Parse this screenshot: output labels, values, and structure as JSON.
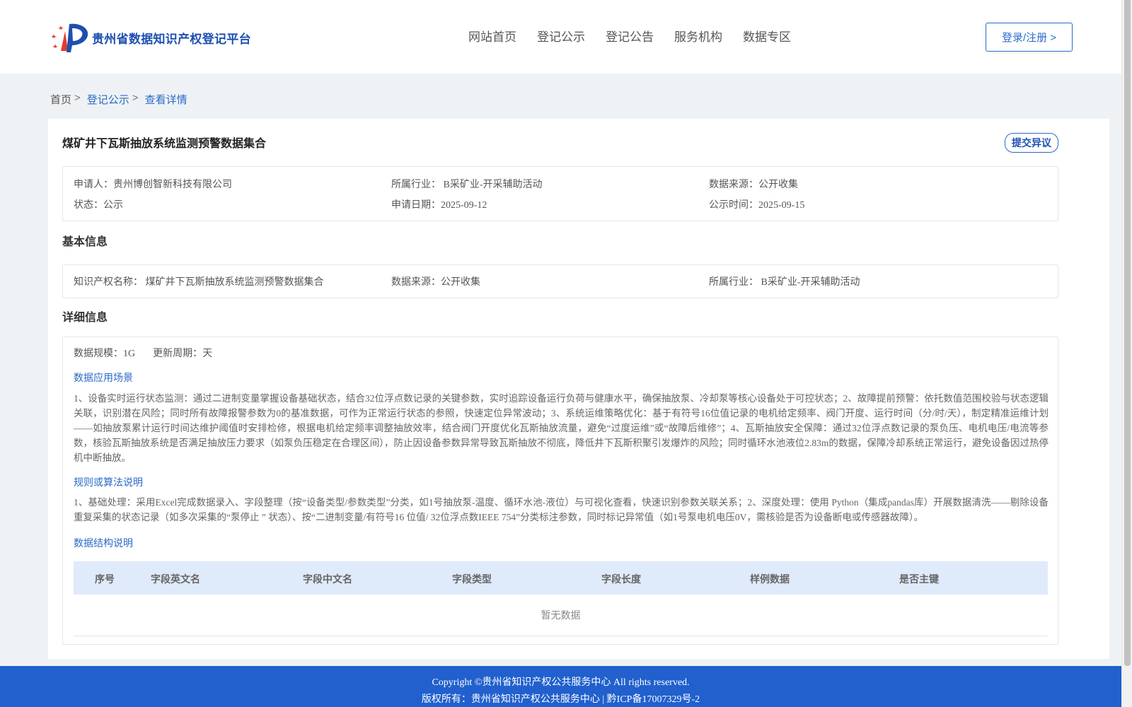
{
  "header": {
    "logo_text": "贵州省数据知识产权登记平台",
    "nav": [
      "网站首页",
      "登记公示",
      "登记公告",
      "服务机构",
      "数据专区"
    ],
    "login_label": "登录/注册 >"
  },
  "breadcrumb": {
    "home": "首页",
    "sep": ">",
    "level1": "登记公示",
    "current": "查看详情"
  },
  "record": {
    "title": "煤矿井下瓦斯抽放系统监测预警数据集合",
    "objection_label": "提交异议",
    "summary": {
      "applicant_label": "申请人：",
      "applicant": "贵州博创智新科技有限公司",
      "industry_label": "所属行业：",
      "industry": "B采矿业-开采辅助活动",
      "source_label": "数据来源：",
      "source": "公开收集",
      "status_label": "状态：",
      "status": "公示",
      "apply_date_label": "申请日期：",
      "apply_date": "2025-09-12",
      "publish_date_label": "公示时间：",
      "publish_date": "2025-09-15"
    }
  },
  "basic_info": {
    "section_title": "基本信息",
    "ip_name_label": "知识产权名称：",
    "ip_name": "煤矿井下瓦斯抽放系统监测预警数据集合",
    "source_label": "数据来源：",
    "source": "公开收集",
    "industry_label": "所属行业：",
    "industry": "B采矿业-开采辅助活动"
  },
  "detail_info": {
    "section_title": "详细信息",
    "scale_label": "数据规模：",
    "scale": "1G",
    "cycle_label": "更新周期：",
    "cycle": "天",
    "scenario_title": "数据应用场景",
    "scenario_text": "1、设备实时运行状态监测：通过二进制变量掌握设备基础状态，结合32位浮点数记录的关键参数，实时追踪设备运行负荷与健康水平，确保抽放泵、冷却泵等核心设备处于可控状态；2、故障提前预警：依托数值范围校验与状态逻辑关联，识别潜在风险；同时所有故障报警参数为0的基准数据，可作为正常运行状态的参照，快速定位异常波动；3、系统运维策略优化：基于有符号16位值记录的电机给定频率、阀门开度、运行时间（分/时/天），制定精准运维计划——如抽放泵累计运行时间达维护阈值时安排检修，根据电机给定频率调整抽放效率，结合阀门开度优化瓦斯抽放流量，避免“过度运维”或“故障后维修”；4、瓦斯抽放安全保障：通过32位浮点数记录的泵负压、电机电压/电流等参数，核验瓦斯抽放系统是否满足抽放压力要求（如泵负压稳定在合理区间），防止因设备参数异常导致瓦斯抽放不彻底，降低井下瓦斯积聚引发爆炸的风险；同时循环水池液位2.83m的数据，保障冷却系统正常运行，避免设备因过热停机中断抽放。",
    "algorithm_title": "规则或算法说明",
    "algorithm_text": "1、基础处理：采用Excel完成数据录入、字段整理（按“设备类型/参数类型”分类，如1号抽放泵-温度、循环水池-液位）与可视化查看，快速识别参数关联关系；2、深度处理：使用 Python（集成pandas库）开展数据清洗——剔除设备重复采集的状态记录（如多次采集的“泵停止 ” 状态）、按“二进制变量/有符号16 位值/ 32位浮点数IEEE 754”分类标注参数，同时标记异常值（如1号泵电机电压0V，需核验是否为设备断电或传感器故障）。",
    "structure_title": "数据结构说明",
    "table_headers": [
      "序号",
      "字段英文名",
      "字段中文名",
      "字段类型",
      "字段长度",
      "样例数据",
      "是否主键"
    ],
    "empty_text": "暂无数据"
  },
  "footer": {
    "copyright": "Copyright ©贵州省知识产权公共服务中心 All rights reserved.",
    "owner": "版权所有：贵州省知识产权公共服务中心 | 黔ICP备17007329号-2"
  },
  "colors": {
    "brand_blue": "#2a6ac8",
    "footer_blue": "#2160cd",
    "table_header_bg": "#dfeafb"
  }
}
